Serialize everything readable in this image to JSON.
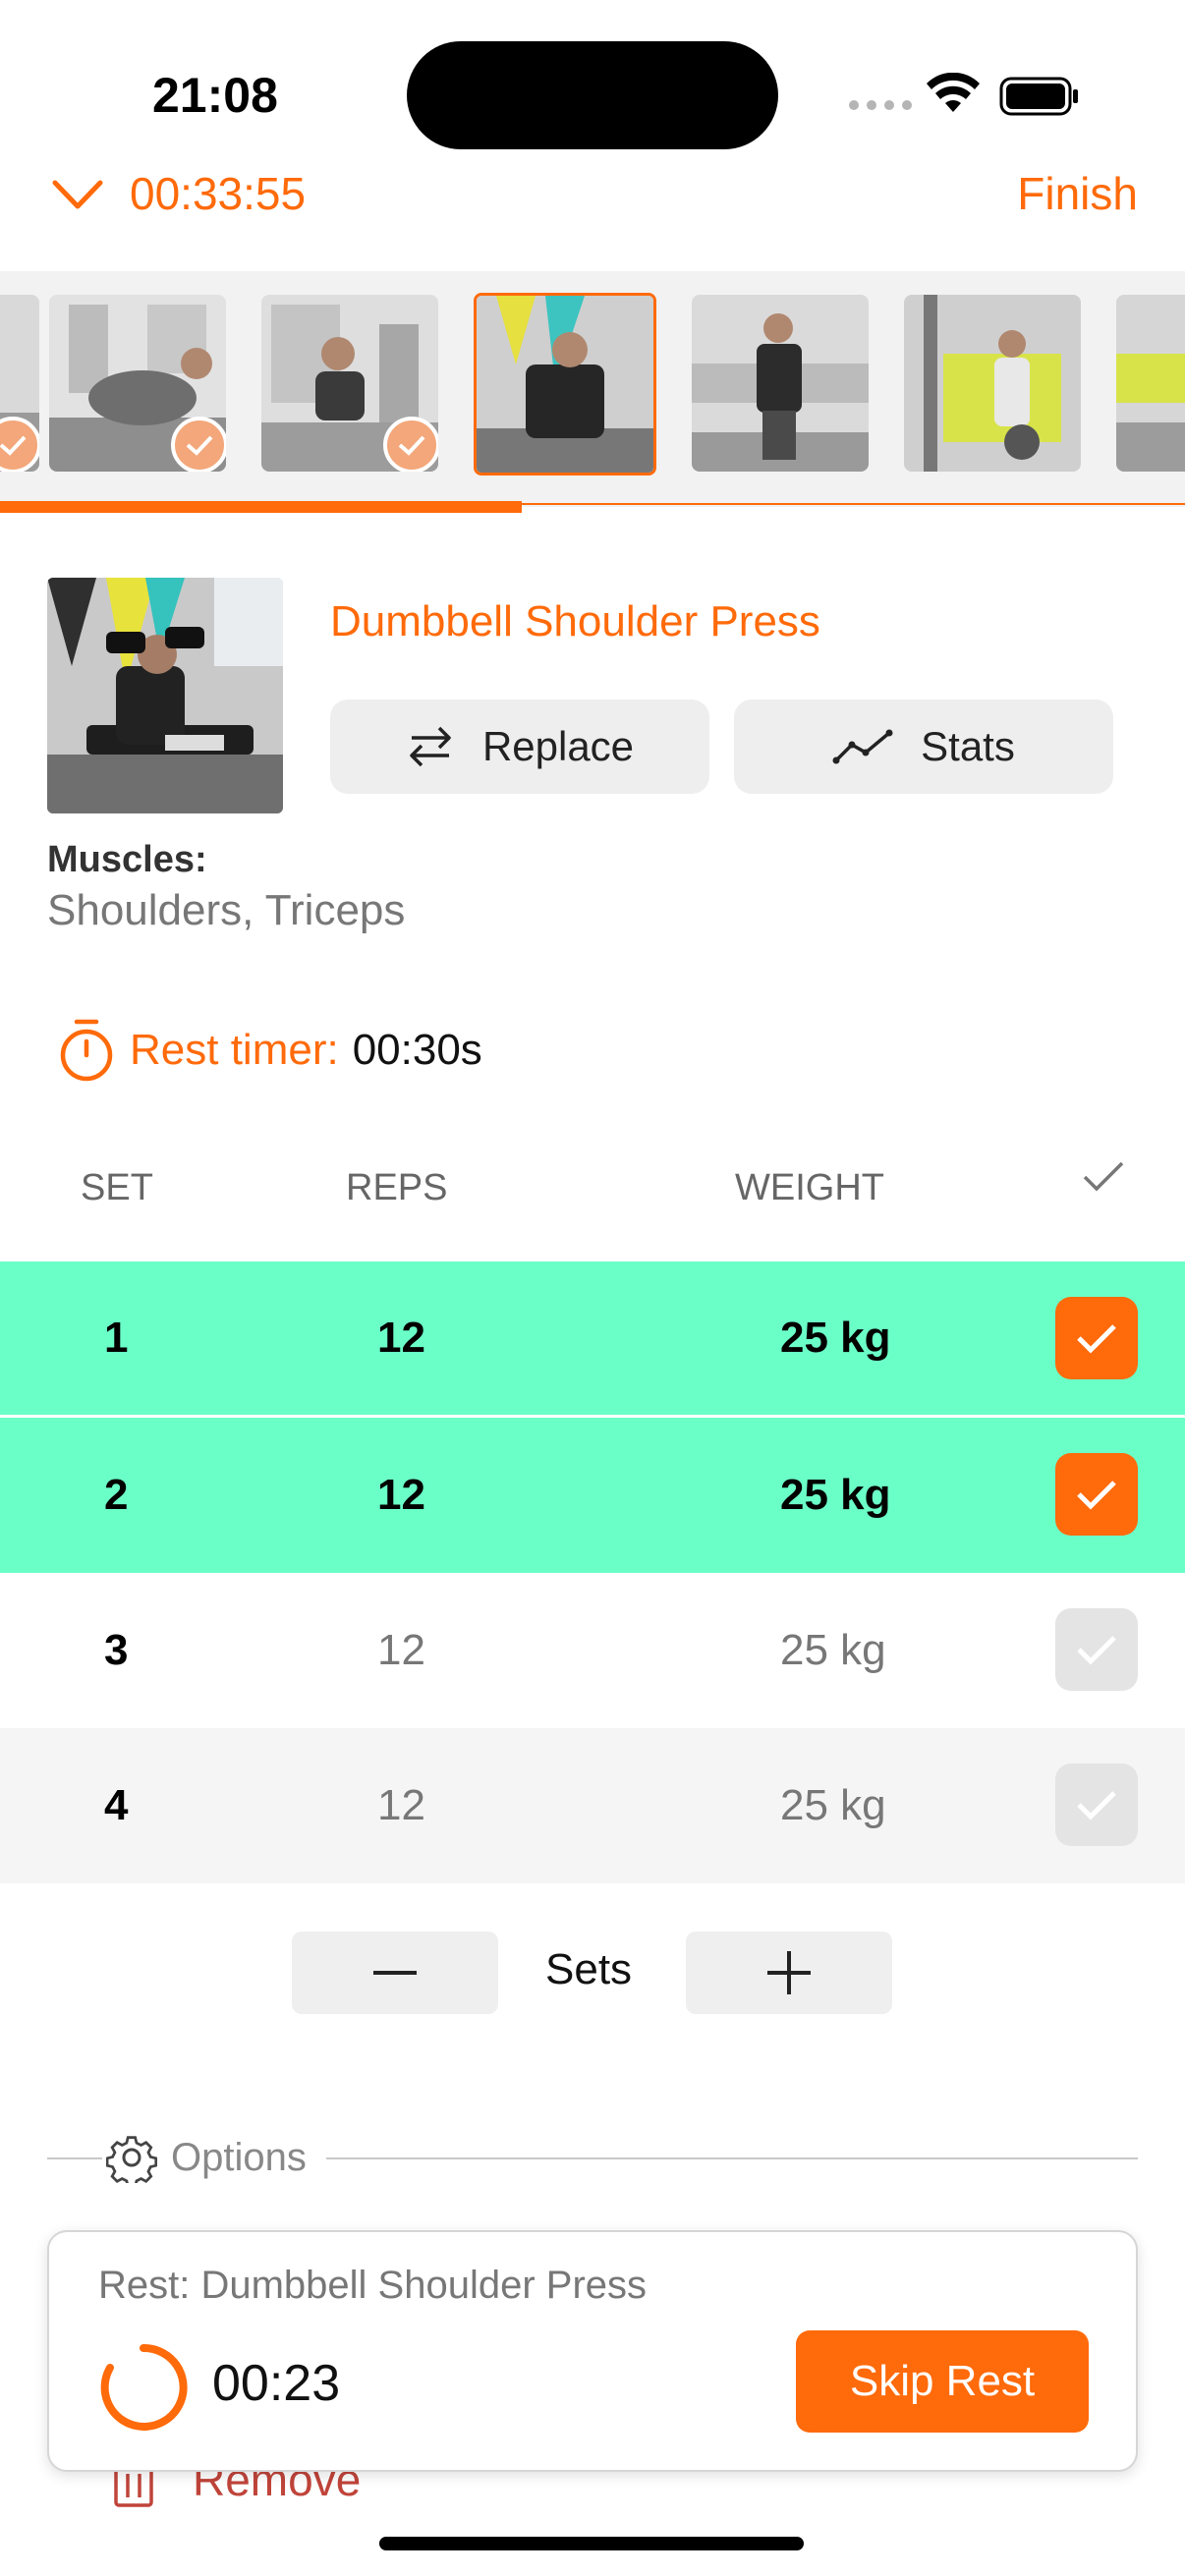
{
  "status_bar": {
    "time": "21:08",
    "icons": [
      "signal-dots-icon",
      "wifi-icon",
      "battery-icon"
    ]
  },
  "header": {
    "elapsed": "00:33:55",
    "finish_label": "Finish",
    "icon": "chevron-down-icon"
  },
  "thumbnails": [
    {
      "done": true,
      "active": false
    },
    {
      "done": true,
      "active": false
    },
    {
      "done": true,
      "active": false
    },
    {
      "done": false,
      "active": true
    },
    {
      "done": false,
      "active": false
    },
    {
      "done": false,
      "active": false
    },
    {
      "done": false,
      "active": false
    }
  ],
  "workout_progress": 0.44,
  "exercise": {
    "name": "Dumbbell Shoulder Press",
    "replace_label": "Replace",
    "stats_label": "Stats",
    "muscles_label": "Muscles:",
    "muscles_value": "Shoulders, Triceps"
  },
  "rest_timer": {
    "label": "Rest timer:",
    "value": "00:30s"
  },
  "table": {
    "headers": {
      "set": "SET",
      "reps": "REPS",
      "weight": "WEIGHT"
    },
    "rows": [
      {
        "set": "1",
        "reps": "12",
        "weight": "25 kg",
        "completed": true
      },
      {
        "set": "2",
        "reps": "12",
        "weight": "25 kg",
        "completed": true
      },
      {
        "set": "3",
        "reps": "12",
        "weight": "25 kg",
        "completed": false
      },
      {
        "set": "4",
        "reps": "12",
        "weight": "25 kg",
        "completed": false
      }
    ]
  },
  "sets_control": {
    "label": "Sets"
  },
  "options": {
    "label": "Options"
  },
  "remove": {
    "label": "Remove"
  },
  "rest_card": {
    "title": "Rest: Dumbbell Shoulder Press",
    "countdown": "00:23",
    "skip_label": "Skip Rest"
  },
  "colors": {
    "accent": "#ff6a0a",
    "completed_row": "#6bffc8",
    "alt_row": "#f5f5f5",
    "remove": "#c0443a"
  }
}
